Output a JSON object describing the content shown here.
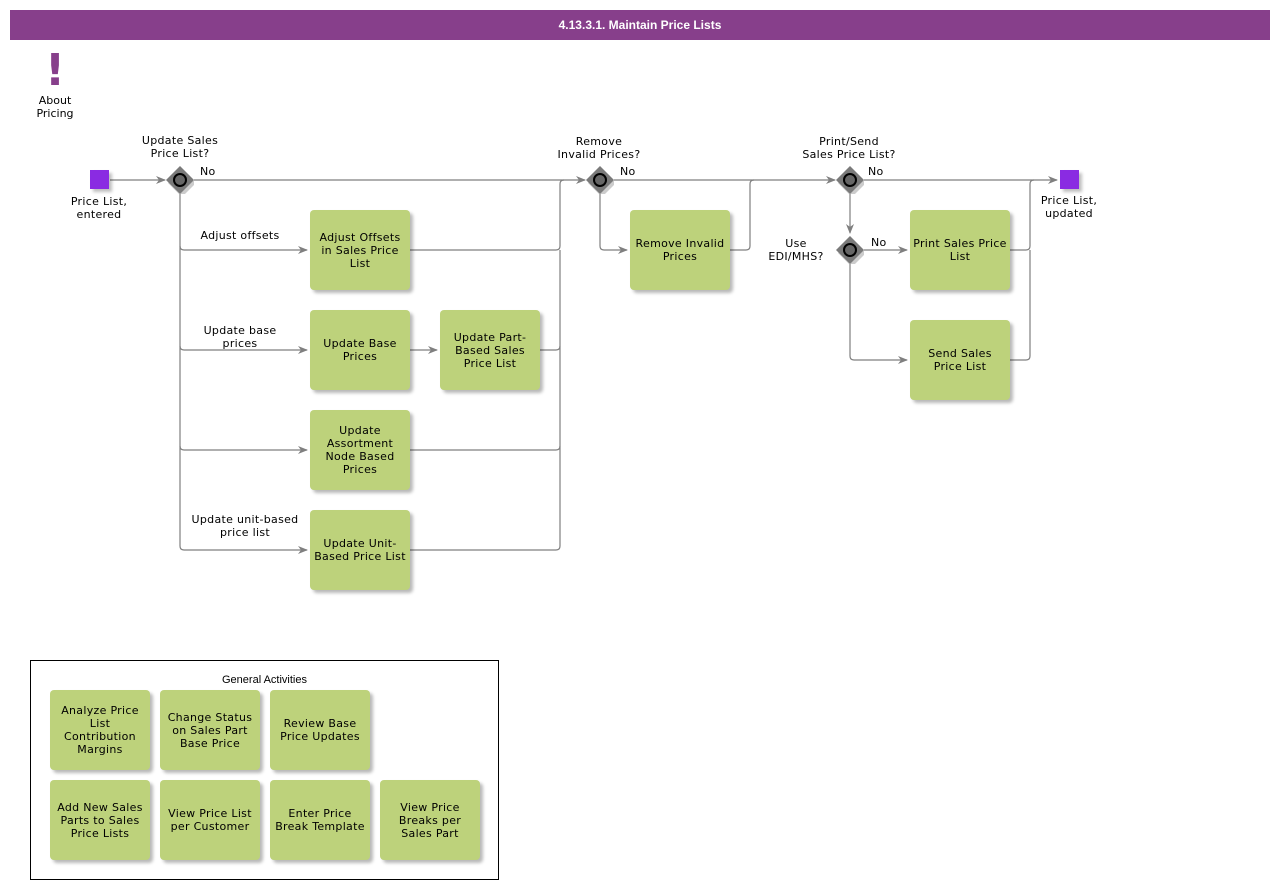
{
  "title": "4.13.3.1. Maintain Price Lists",
  "about": {
    "icon": "exclamation-icon",
    "label": "About\nPricing"
  },
  "events": {
    "start": {
      "label": "Price List,\nentered"
    },
    "end": {
      "label": "Price List,\nupdated"
    }
  },
  "gateways": {
    "update_sales": {
      "question": "Update Sales\nPrice List?",
      "no_label": "No"
    },
    "remove_invalid": {
      "question": "Remove\nInvalid Prices?",
      "no_label": "No"
    },
    "print_send": {
      "question": "Print/Send\nSales Price List?",
      "no_label": "No"
    },
    "use_edi": {
      "question": "Use\nEDI/MHS?",
      "no_label": "No"
    }
  },
  "flow_labels": {
    "adjust_offsets": "Adjust offsets",
    "update_base": "Update base\nprices",
    "update_unit": "Update unit-based\nprice list"
  },
  "tasks": {
    "adjust_offsets": "Adjust Offsets in Sales Price List",
    "update_base_prices": "Update Base Prices",
    "update_part_based": "Update Part-Based Sales Price List",
    "update_assortment": "Update Assortment Node Based Prices",
    "update_unit_based": "Update Unit-Based Price List",
    "remove_invalid": "Remove Invalid Prices",
    "print_sales": "Print Sales Price List",
    "send_sales": "Send Sales Price List"
  },
  "general_activities": {
    "title": "General Activities",
    "items": [
      "Analyze Price List Contribution Margins",
      "Change Status on Sales Part Base Price",
      "Review Base Price Updates",
      "Add New Sales Parts to Sales Price Lists",
      "View Price List per Customer",
      "Enter Price Break Template",
      "View Price Breaks per Sales Part"
    ]
  },
  "colors": {
    "header": "#873f8b",
    "task": "#bdd27b",
    "event": "#8a2be2",
    "gateway": "#7a7a7a",
    "connector": "#7f7f7f"
  }
}
